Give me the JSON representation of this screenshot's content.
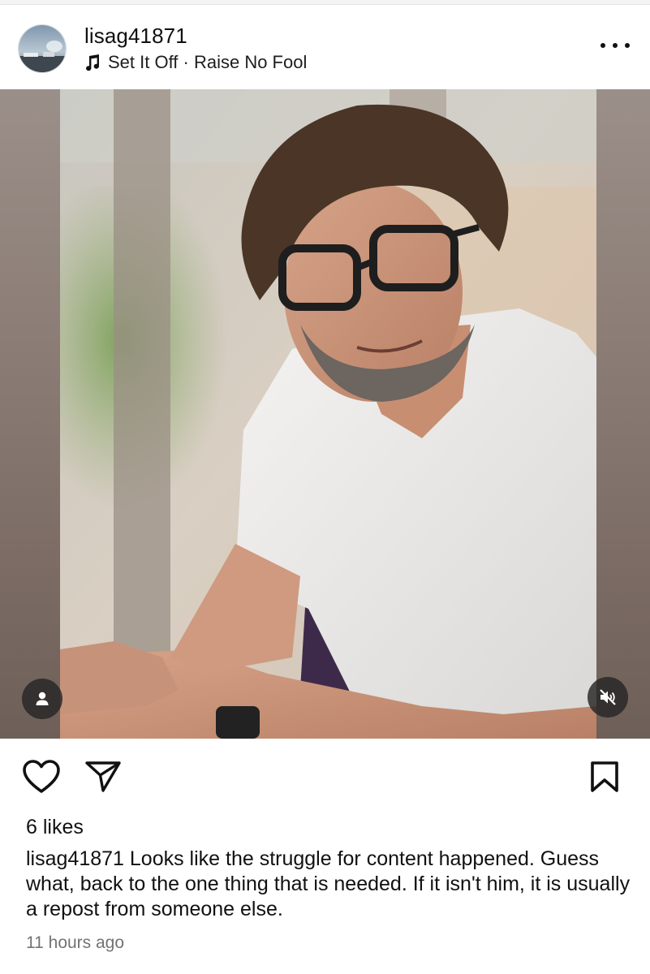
{
  "post": {
    "username": "lisag41871",
    "audio": "Set It Off · Raise No Fool",
    "likes": "6 likes",
    "caption_username": "lisag41871",
    "caption_text": " Looks like the struggle for content happened. Guess what,  back to the one thing that is needed. If it isn't him, it is usually a repost from someone else.",
    "timestamp": "11 hours ago"
  },
  "icons": {
    "audio": "music-note-icon",
    "more": "more-options-icon",
    "tags": "user-tag-icon",
    "mute": "muted-speaker-icon",
    "like": "heart-icon",
    "share": "paper-plane-icon",
    "save": "bookmark-icon"
  },
  "colors": {
    "text": "#111111",
    "secondary_text": "#737373",
    "overlay_button": "#262626"
  }
}
